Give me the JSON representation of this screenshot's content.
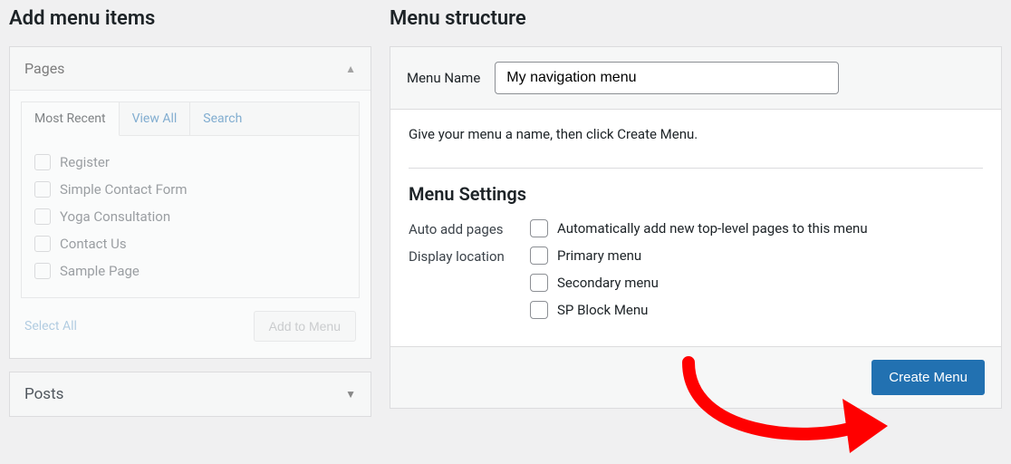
{
  "left": {
    "title": "Add menu items",
    "pages": {
      "header": "Pages",
      "tabs": {
        "recent": "Most Recent",
        "all": "View All",
        "search": "Search"
      },
      "items": [
        "Register",
        "Simple Contact Form",
        "Yoga Consultation",
        "Contact Us",
        "Sample Page"
      ],
      "select_all": "Select All",
      "add_btn": "Add to Menu"
    },
    "posts": {
      "header": "Posts"
    }
  },
  "right": {
    "title": "Menu structure",
    "name_label": "Menu Name",
    "name_value": "My navigation menu",
    "helper": "Give your menu a name, then click Create Menu.",
    "settings_title": "Menu Settings",
    "auto_add": {
      "label": "Auto add pages",
      "option": "Automatically add new top-level pages to this menu"
    },
    "display": {
      "label": "Display location",
      "options": [
        "Primary menu",
        "Secondary menu",
        "SP Block Menu"
      ]
    },
    "create_btn": "Create Menu"
  }
}
